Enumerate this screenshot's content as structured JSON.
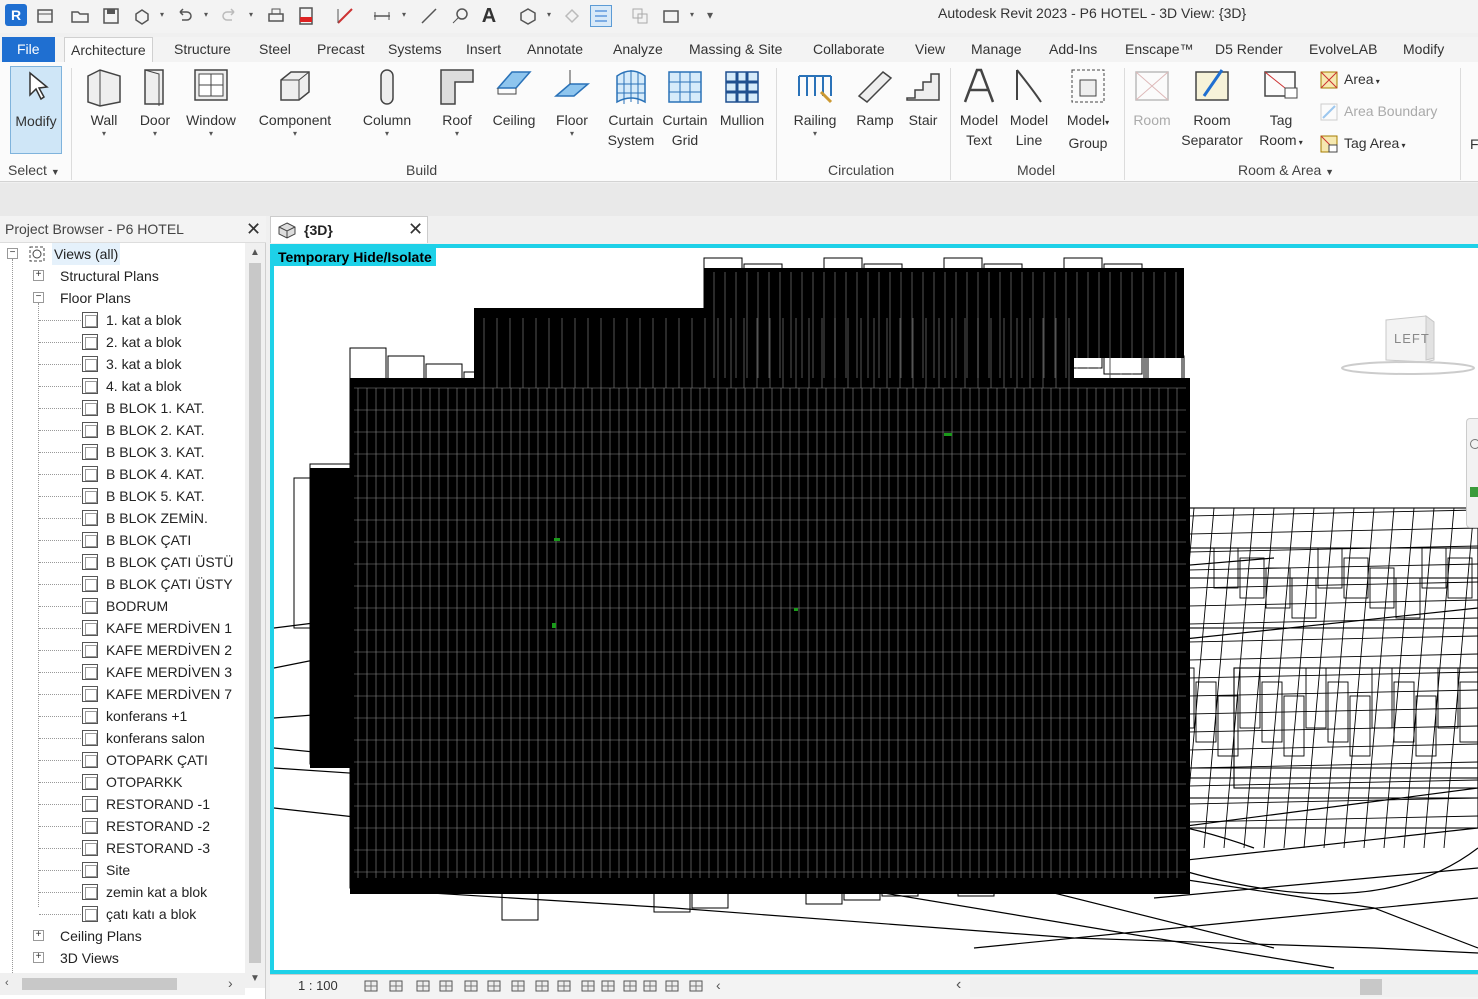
{
  "window": {
    "app_logo": "R",
    "title": "Autodesk Revit 2023 - P6 HOTEL - 3D View: {3D}"
  },
  "ribbon_tabs": [
    "File",
    "Architecture",
    "Structure",
    "Steel",
    "Precast",
    "Systems",
    "Insert",
    "Annotate",
    "Analyze",
    "Massing & Site",
    "Collaborate",
    "View",
    "Manage",
    "Add-Ins",
    "Enscape™",
    "D5 Render",
    "EvolveLAB",
    "Modify"
  ],
  "ribbon": {
    "select": {
      "modify": "Modify",
      "panel": "Select"
    },
    "build": {
      "panel": "Build",
      "wall": "Wall",
      "door": "Door",
      "window": "Window",
      "component": "Component",
      "column": "Column",
      "roof": "Roof",
      "ceiling": "Ceiling",
      "floor": "Floor",
      "curtain_system_1": "Curtain",
      "curtain_system_2": "System",
      "curtain_grid_1": "Curtain",
      "curtain_grid_2": "Grid",
      "mullion": "Mullion"
    },
    "circulation": {
      "panel": "Circulation",
      "railing": "Railing",
      "ramp": "Ramp",
      "stair": "Stair"
    },
    "model": {
      "panel": "Model",
      "model_text_1": "Model",
      "model_text_2": "Text",
      "model_line_1": "Model",
      "model_line_2": "Line",
      "model_group_1": "Model",
      "model_group_2": "Group"
    },
    "room_area": {
      "panel": "Room & Area",
      "room": "Room",
      "room_separator_1": "Room",
      "room_separator_2": "Separator",
      "tag_room_1": "Tag",
      "tag_room_2": "Room",
      "area": "Area",
      "area_boundary": "Area  Boundary",
      "tag_area": "Tag  Area"
    },
    "overflow": "F"
  },
  "project_browser": {
    "title": "Project Browser - P6 HOTEL",
    "root": "Views (all)",
    "structural_plans": "Structural Plans",
    "floor_plans": "Floor Plans",
    "floor_plan_items": [
      "1. kat a blok",
      "2. kat a blok",
      "3. kat a blok",
      "4. kat a blok",
      "B BLOK 1. KAT.",
      "B BLOK 2. KAT.",
      "B BLOK 3. KAT.",
      "B BLOK 4. KAT.",
      "B BLOK 5. KAT.",
      "B BLOK ZEMİN.",
      "B BLOK ÇATI",
      "B BLOK ÇATI ÜSTÜ",
      "B BLOK ÇATI ÜSTY",
      "BODRUM",
      "KAFE MERDİVEN 1",
      "KAFE MERDİVEN 2",
      "KAFE MERDİVEN 3",
      "KAFE MERDİVEN 7",
      "konferans +1",
      "konferans salon",
      "OTOPARK ÇATI",
      "OTOPARKK",
      "RESTORAND -1",
      "RESTORAND -2",
      "RESTORAND -3",
      "Site",
      "zemin kat a blok",
      "çatı katı a blok"
    ],
    "ceiling_plans": "Ceiling Plans",
    "views_3d": "3D Views"
  },
  "view": {
    "tab_title": "{3D}",
    "temp_label": "Temporary Hide/Isolate",
    "viewcube_face": "LEFT",
    "scale": "1 : 100"
  },
  "colors": {
    "accent": "#1f6fd1",
    "isolate_border": "#1ed1e8",
    "select_active": "#cfe6f7"
  }
}
